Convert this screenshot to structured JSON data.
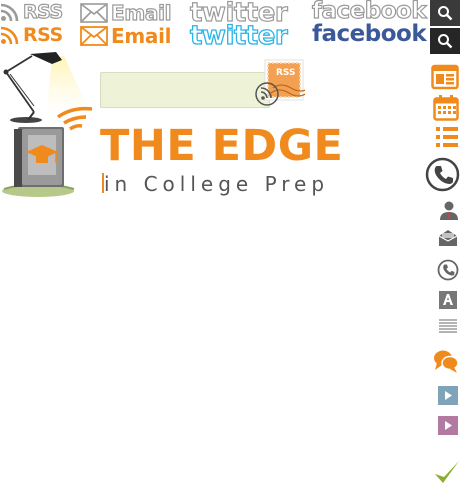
{
  "social": {
    "rss_label": "RSS",
    "email_label": "Email",
    "twitter_label": "twitter",
    "facebook_label": "facebook"
  },
  "brand": {
    "title": "THE EDGE",
    "subtitle": "in College Prep",
    "orange": "#f18a1c",
    "twitter_blue": "#29b3e8",
    "facebook_blue": "#3b5998"
  },
  "stamp_label": "RSS",
  "search": {
    "placeholder": ""
  },
  "sidebar": {
    "icons": [
      "news-icon",
      "calendar-icon",
      "list-icon",
      "phone-circle-icon",
      "person-icon",
      "mail-icon",
      "phone-icon",
      "font-size-icon",
      "text-lines-icon",
      "chat-icon",
      "arrow-right-blue-icon",
      "arrow-right-purple-icon",
      "checkmark-icon"
    ]
  }
}
